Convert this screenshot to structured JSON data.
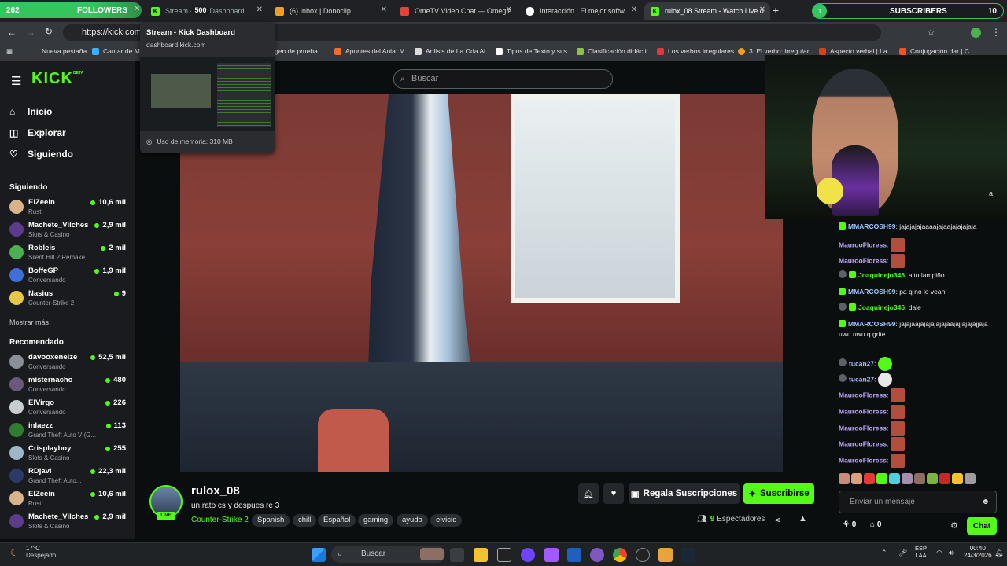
{
  "overlay": {
    "followers_count": "262",
    "followers_label": "FOLLOWERS",
    "followers_goal": "500",
    "subscribers_count": "1",
    "subscribers_label": "SUBSCRIBERS",
    "subscribers_goal": "10"
  },
  "tabs": [
    {
      "label": "Stream - Kick Dashboard"
    },
    {
      "label": "(6) Inbox | Donoclip"
    },
    {
      "label": "OmeTV Video Chat — Omegle"
    },
    {
      "label": "Interacción | El mejor softw"
    },
    {
      "label": "rulox_08 Stream - Watch Live o"
    }
  ],
  "address": {
    "url": "https://kick.com/r"
  },
  "bookmarks": [
    "Nueva pestaña",
    "Cantar de Mi",
    "gen de prueba...",
    "Apuntes del Aula: M...",
    "Anlisis de La Oda Al...",
    "Tipos de Texto y sus...",
    "Clasificación didácti...",
    "Los verbos irregulares",
    "3. El verbo: irregular...",
    "Aspecto verbal | La...",
    "Conjugación dar | C..."
  ],
  "tooltip": {
    "title": "Stream - Kick Dashboard",
    "url": "dashboard.kick.com",
    "memory": "Uso de memoria: 310 MB"
  },
  "sidebar": {
    "logo": "KICK",
    "logo_badge": "BETA",
    "nav": [
      {
        "label": "Inicio"
      },
      {
        "label": "Explorar"
      },
      {
        "label": "Siguiendo"
      }
    ],
    "following_title": "Siguiendo",
    "following": [
      {
        "name": "ElZeein",
        "category": "Rust",
        "viewers": "10,6 mil"
      },
      {
        "name": "Machete_Vilches",
        "category": "Slots & Casino",
        "viewers": "2,9 mil"
      },
      {
        "name": "Robleis",
        "category": "Silent Hill 2 Remake",
        "viewers": "2 mil"
      },
      {
        "name": "BoffeGP",
        "category": "Conversando",
        "viewers": "1,9 mil"
      },
      {
        "name": "Nasius",
        "category": "Counter-Strike 2",
        "viewers": "9"
      }
    ],
    "show_more": "Mostrar más",
    "recommended_title": "Recomendado",
    "recommended": [
      {
        "name": "davooxeneize",
        "category": "Conversando",
        "viewers": "52,5 mil"
      },
      {
        "name": "misternacho",
        "category": "Conversando",
        "viewers": "480"
      },
      {
        "name": "ElVirgo",
        "category": "Conversando",
        "viewers": "226"
      },
      {
        "name": "inlaezz",
        "category": "Grand Theft Auto V (G...",
        "viewers": "113"
      },
      {
        "name": "Crisplayboy",
        "category": "Slots & Casino",
        "viewers": "255"
      },
      {
        "name": "RDjavi",
        "category": "Grand Theft Auto...",
        "viewers": "22,3 mil"
      },
      {
        "name": "ElZeein",
        "category": "Rust",
        "viewers": "10,6 mil"
      },
      {
        "name": "Machete_Vilches",
        "category": "Slots & Casino",
        "viewers": "2,9 mil"
      }
    ]
  },
  "search": {
    "placeholder": "Buscar"
  },
  "stream": {
    "channel": "rulox_08",
    "live": "LIVE",
    "title": "un rato cs y despues re 3",
    "category": "Counter-Strike 2",
    "tags": [
      "Spanish",
      "chill",
      "Español",
      "gaming",
      "ayuda",
      "elvicio"
    ],
    "gift_label": "Regala Suscripciones",
    "subscribe_label": "Suscribirse",
    "viewers_count": "9",
    "viewers_label": "Espectadores"
  },
  "chat": {
    "side_char": "a",
    "messages": [
      {
        "user": "MMARCOSH99",
        "text": "jajajajajaaaajajaajajajajaja"
      },
      {
        "user": "MaurooFloress",
        "text": ""
      },
      {
        "user": "MaurooFloress",
        "text": ""
      },
      {
        "user": "Joaquinejo346",
        "text": "alto lampiño"
      },
      {
        "user": "MMARCOSH99",
        "text": "pa q no lo vean"
      },
      {
        "user": "Joaquinejo346",
        "text": "dale"
      },
      {
        "user": "MMARCOSH99",
        "text": "jajajaajajajajajajaajajjajajajjaja uwu uwu q grite"
      },
      {
        "user": "tucan27",
        "text": ""
      },
      {
        "user": "tucan27",
        "text": ""
      },
      {
        "user": "MaurooFloress",
        "text": ""
      },
      {
        "user": "MaurooFloress",
        "text": ""
      },
      {
        "user": "MaurooFloress",
        "text": ""
      },
      {
        "user": "MaurooFloress",
        "text": ""
      },
      {
        "user": "MaurooFloress",
        "text": ""
      }
    ],
    "input_placeholder": "Enviar un mensaje",
    "footer_a": "0",
    "footer_b": "0",
    "send_label": "Chat"
  },
  "taskbar": {
    "temperature": "17°C",
    "weather": "Despejado",
    "search": "Buscar",
    "lang_top": "ESP",
    "lang_bottom": "LAA",
    "time": "00:40",
    "date": "24/3/2026"
  },
  "colors": {
    "kick_green": "#53fc18",
    "overlay_green": "#35c45e",
    "bg": "#0b0e0f",
    "sidebar": "#191b1f"
  }
}
